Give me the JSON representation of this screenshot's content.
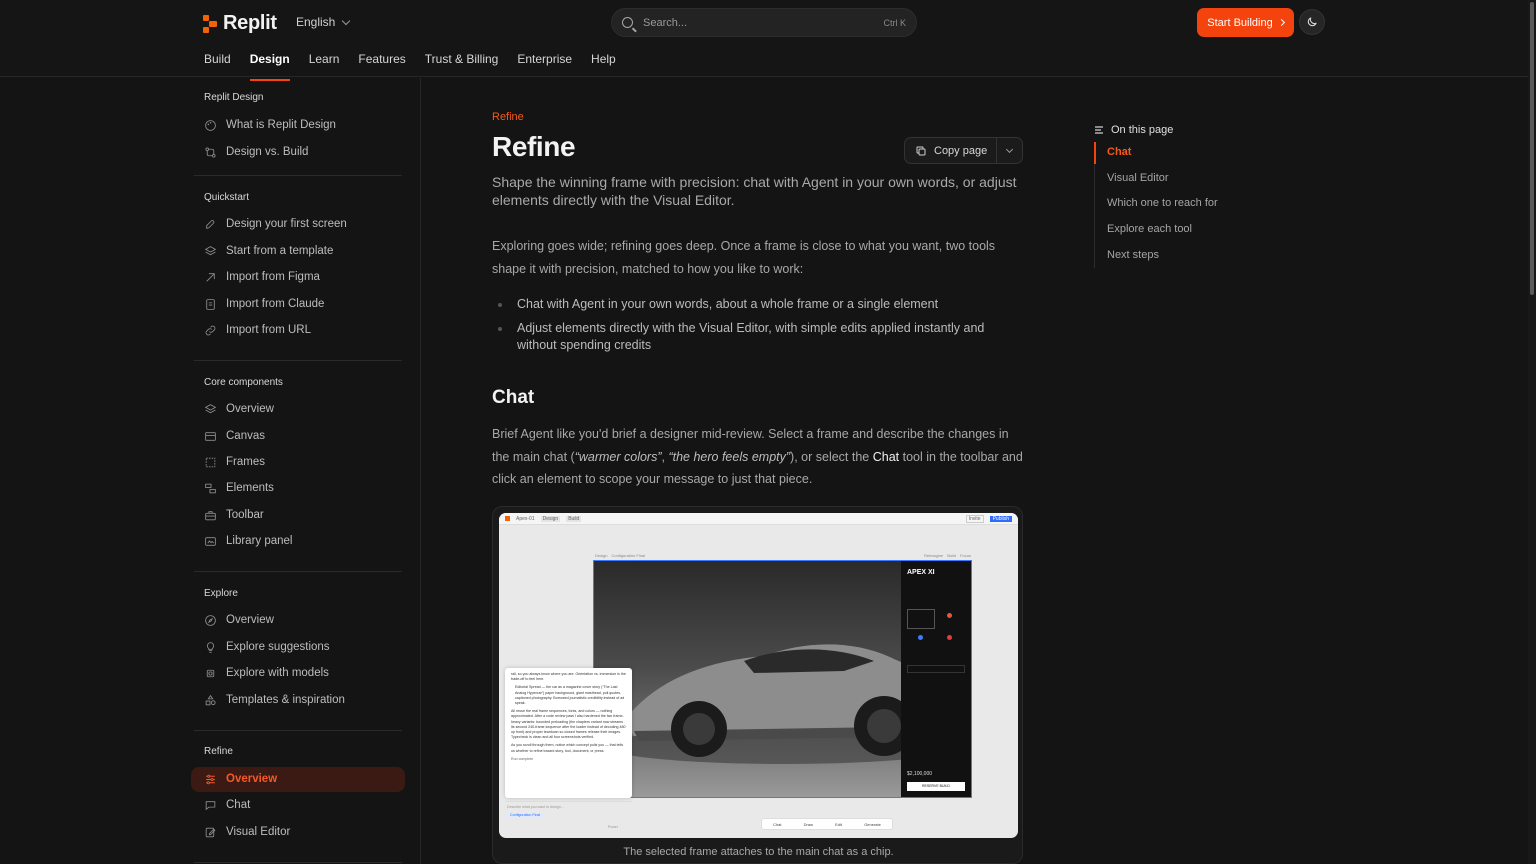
{
  "header": {
    "brand": "Replit",
    "language": "English",
    "search_placeholder": "Search...",
    "search_shortcut": "Ctrl K",
    "start_button": "Start Building",
    "accent_color": "#f4430d"
  },
  "nav": {
    "tabs": [
      {
        "label": "Build",
        "active": false
      },
      {
        "label": "Design",
        "active": true
      },
      {
        "label": "Learn",
        "active": false
      },
      {
        "label": "Features",
        "active": false
      },
      {
        "label": "Trust & Billing",
        "active": false
      },
      {
        "label": "Enterprise",
        "active": false
      },
      {
        "label": "Help",
        "active": false
      }
    ]
  },
  "sidebar": {
    "sections": [
      {
        "title": "Replit Design",
        "items": [
          {
            "label": "What is Replit Design",
            "icon": "palette-icon"
          },
          {
            "label": "Design vs. Build",
            "icon": "compare-icon"
          }
        ]
      },
      {
        "title": "Quickstart",
        "items": [
          {
            "label": "Design your first screen",
            "icon": "rocket-icon"
          },
          {
            "label": "Start from a template",
            "icon": "layers-icon"
          },
          {
            "label": "Import from Figma",
            "icon": "figma-icon"
          },
          {
            "label": "Import from Claude",
            "icon": "document-icon"
          },
          {
            "label": "Import from URL",
            "icon": "link-icon"
          }
        ]
      },
      {
        "title": "Core components",
        "items": [
          {
            "label": "Overview",
            "icon": "layers-icon"
          },
          {
            "label": "Canvas",
            "icon": "canvas-icon"
          },
          {
            "label": "Frames",
            "icon": "frame-icon"
          },
          {
            "label": "Elements",
            "icon": "elements-icon"
          },
          {
            "label": "Toolbar",
            "icon": "toolbox-icon"
          },
          {
            "label": "Library panel",
            "icon": "library-icon"
          }
        ]
      },
      {
        "title": "Explore",
        "items": [
          {
            "label": "Overview",
            "icon": "compass-icon"
          },
          {
            "label": "Explore suggestions",
            "icon": "lightbulb-icon"
          },
          {
            "label": "Explore with models",
            "icon": "chip-icon"
          },
          {
            "label": "Templates & inspiration",
            "icon": "shapes-icon"
          }
        ]
      },
      {
        "title": "Refine",
        "items": [
          {
            "label": "Overview",
            "icon": "sliders-icon",
            "active": true
          },
          {
            "label": "Chat",
            "icon": "chat-icon"
          },
          {
            "label": "Visual Editor",
            "icon": "edit-icon"
          }
        ]
      }
    ]
  },
  "main": {
    "eyebrow": "Refine",
    "title": "Refine",
    "copy_button": "Copy page",
    "subtitle": "Shape the winning frame with precision: chat with Agent in your own words, or adjust elements directly with the Visual Editor.",
    "intro": "Exploring goes wide; refining goes deep. Once a frame is close to what you want, two tools shape it with precision, matched to how you like to work:",
    "bullets": [
      "Chat with Agent in your own words, about a whole frame or a single element",
      "Adjust elements directly with the Visual Editor, with simple edits applied instantly and without spending credits"
    ],
    "chat_heading": "Chat",
    "chat_para": {
      "p1": "Brief Agent like you'd brief a designer mid-review. Select a frame and describe the changes in the main chat (",
      "q1": "“warmer colors”",
      "sep": ", ",
      "q2": "“the hero feels empty”",
      "p2": "), or select the ",
      "chat_word": "Chat",
      "p3": " tool in the toolbar and click an element to scope your message to just that piece."
    },
    "figure": {
      "caption": "The selected frame attaches to the main chat as a chip.",
      "app_tabs": [
        "Apex-01",
        "Design",
        "Build"
      ],
      "app_buttons": [
        "Invite",
        "Publish"
      ],
      "frame_crumbs": [
        "Design",
        "Configuration Final"
      ],
      "frame_tools": [
        "Reimagine",
        "Build",
        "Focus"
      ],
      "panel_title": "APEX XI",
      "panel_price": "$2,100,000",
      "panel_cta": "RESERVE BUILD",
      "chat_lines": [
        "rail, so you always know where you are. Orientation vs. immersion is the trade-off to feel here.",
        "Editorial Spread — the car as a magazine cover story (“The Last Analog Hypercar”) paper background, giant masthead, pull quotes, captioned photography. Borrowed journalistic credibility instead of ad speak.",
        "All reuse the real frame sequences, fonts, and colors — nothing approximated. After a code review pass I also hardened the two frame-heavy variants: bounded preloading (the chapters variant now streams its second 240-frame sequence after the loader instead of decoding 480 up front) and proper teardown so closed frames release their images. Typecheck is clean and all four screenshots verified.",
        "As you scroll through them, notice which concept pulls you — that tells us whether to refine toward story, tool, document, or press."
      ],
      "chat_status": "Run complete",
      "chat_placeholder": "Describe what you want to design...",
      "chat_chip": "Configuration Final",
      "chat_mode": "Power",
      "toolbar_items": [
        "Chat",
        "Draw",
        "Edit",
        "Generate"
      ]
    }
  },
  "toc": {
    "title": "On this page",
    "items": [
      {
        "label": "Chat",
        "active": true
      },
      {
        "label": "Visual Editor",
        "active": false
      },
      {
        "label": "Which one to reach for",
        "active": false
      },
      {
        "label": "Explore each tool",
        "active": false
      },
      {
        "label": "Next steps",
        "active": false
      }
    ]
  }
}
